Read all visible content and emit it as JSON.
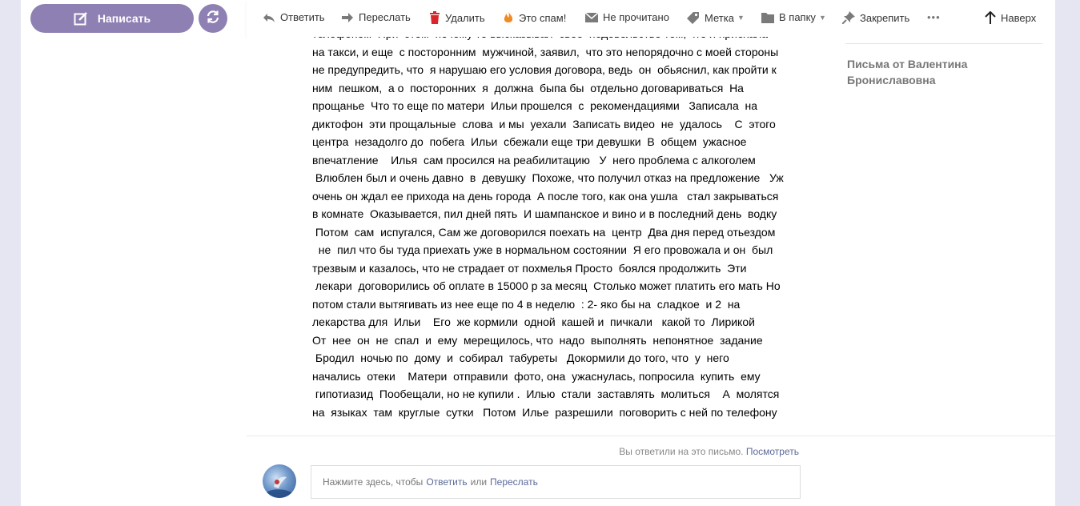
{
  "app": {
    "compose_label": "Написать"
  },
  "toolbar": {
    "reply": "Ответить",
    "forward": "Переслать",
    "delete": "Удалить",
    "spam": "Это спам!",
    "unread": "Не прочитано",
    "label": "Метка",
    "to_folder": "В папку",
    "pin": "Закрепить",
    "more": "•••",
    "up": "Наверх"
  },
  "letter": {
    "lines": [
      "телефоном  При  этом  почему то высказывал  свое  недовольство тем, что я приехала",
      "на такси, и еще  с посторонним  мужчиной, заявил,  что это непорядочно с моей стороны",
      "не предупредить, что  я нарушаю его условия договора, ведь  он  обьяснил, как пройти к",
      "ним  пешком,  а о  посторонних  я  должна  быпа бы  отдельно договариваться  На",
      "прощанье  Что то еще по матери  Ильи прошелся  с  рекомендациями   Записала  на",
      "диктофон  эти прощальные  слова  и мы  уехали  Записать видео  не  удалось    С  этого",
      "центра  незадолго до  побега  Ильи  сбежали еще три девушки  В  общем  ужасное",
      "впечатление    Илья  сам просился на реабилитацию   У  него проблема с алкоголем",
      " Влюблен был и очень давно  в  девушку  Похоже, что получил отказ на предложение   Уж",
      "очень он ждал ее прихода на день города  А после того, как она ушла   стал закрываться",
      "в комнате  Оказывается, пил дней пять  И шампанское и вино и в последний день  водку",
      " Потом  сам  испугался, Сам же договорился поехать на  центр  Два дня перед отьездом",
      "  не  пил что бы туда приехать уже в нормальном состоянии  Я его провожала и он  был",
      "трезвым и казалось, что не страдает от похмелья Просто  боялся продолжить  Эти",
      " лекари  договорились об оплате в 15000 р за месяц  Столько может платить его мать Но",
      "потом стали вытягивать из нее еще по 4 в неделю  : 2- яко бы на  сладкое  и 2  на",
      "лекарства для  Ильи    Его  же кормили  одной  кашей и  пичкали   какой то  Лирикой",
      "От  нее  он  не  спал  и  ему  мерещилось, что  надо  выполнять  непонятное  задание",
      " Бродил  ночью по  дому  и  собирал  табуреты   Докормили до того, что  у  него",
      "начались  отеки    Матери  отправили  фото, она  ужаснулась, попросила  купить  ему",
      " гипотиазид  Пообещали, но не купили .  Илью  стали  заставлять  молиться    А  молятся",
      "на  языках  там  круглые  сутки   Потом  Илье  разрешили  поговорить с ней по телефону"
    ]
  },
  "sidebar_right": {
    "letters_from": "Письма от Валентина Брониславовна"
  },
  "reply": {
    "replied_text": "Вы ответили на это письмо.",
    "view_link": "Посмотреть",
    "placeholder_prefix": "Нажмите здесь, чтобы",
    "reply_link": "Ответить",
    "or": "или",
    "forward_link": "Переслать"
  },
  "colors": {
    "accent": "#8e80b3",
    "link": "#5b6a99",
    "background": "#e6e6f2",
    "spam_icon": "#f08a24",
    "delete_icon": "#d9262b"
  }
}
